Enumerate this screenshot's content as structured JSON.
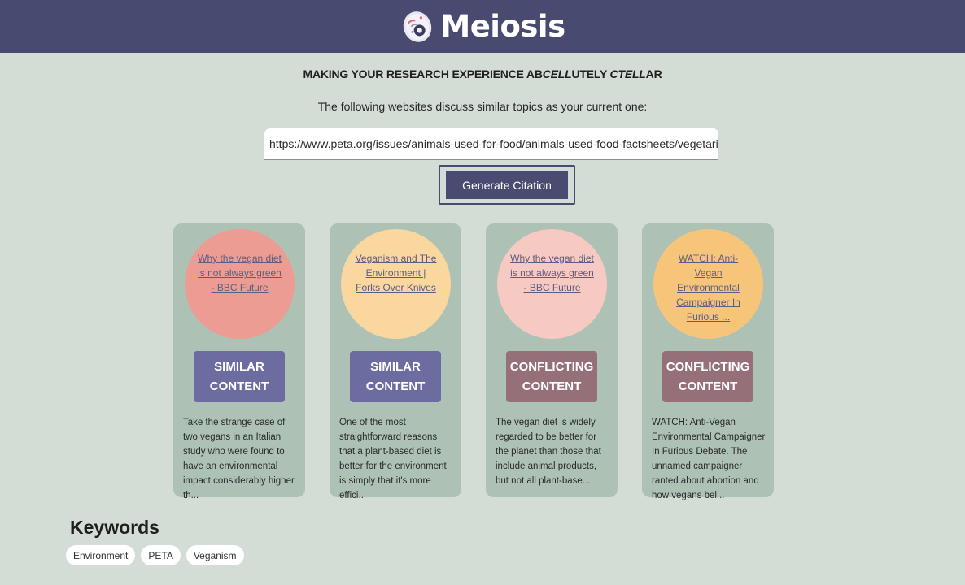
{
  "header": {
    "app_name": "Meiosis",
    "logo_icon": "cell-logo-icon",
    "background_color": "#494a70"
  },
  "tagline": {
    "part1": "MAKING YOUR RESEARCH EXPERIENCE AB",
    "part2": "CELL",
    "part3": "UTELY ",
    "part4": "C",
    "part5": "TELL",
    "part6": "AR"
  },
  "intro_text": "The following websites discuss similar topics as your current one:",
  "url_field": {
    "value": "https://www.peta.org/issues/animals-used-for-food/animals-used-food-factsheets/vegetarian-"
  },
  "citation_button_label": "Generate Citation",
  "cards": [
    {
      "link_text": "Why the vegan diet is not always green - BBC Future",
      "circle_color": "#ec9c93",
      "badge_line1": "SIMILAR",
      "badge_line2": "CONTENT",
      "badge_type": "similar",
      "description": "Take the strange case of two vegans in an Italian study who were found to have an environmental impact considerably higher th..."
    },
    {
      "link_text": "Veganism and The Environment | Forks Over Knives",
      "circle_color": "#f9d79f",
      "badge_line1": "SIMILAR",
      "badge_line2": "CONTENT",
      "badge_type": "similar",
      "description": "One of the most straightforward reasons that a plant-based diet is better for the environment is simply that it's more effici..."
    },
    {
      "link_text": "Why the vegan diet is not always green - BBC Future",
      "circle_color": "#f6c9c2",
      "badge_line1": "CONFLICTING",
      "badge_line2": "CONTENT",
      "badge_type": "conflicting",
      "description": "The vegan diet is widely regarded to be better for the planet than those that include animal products, but not all plant-base..."
    },
    {
      "link_text": "WATCH: Anti-Vegan Environmental Campaigner In Furious ...",
      "circle_color": "#f6c57a",
      "badge_line1": "CONFLICTING",
      "badge_line2": "CONTENT",
      "badge_type": "conflicting",
      "description": "WATCH: Anti-Vegan Environmental Campaigner In Furious Debate. The unnamed campaigner ranted about abortion and how vegans bel..."
    }
  ],
  "keywords": {
    "title": "Keywords",
    "items": [
      "Environment",
      "PETA",
      "Veganism"
    ]
  }
}
